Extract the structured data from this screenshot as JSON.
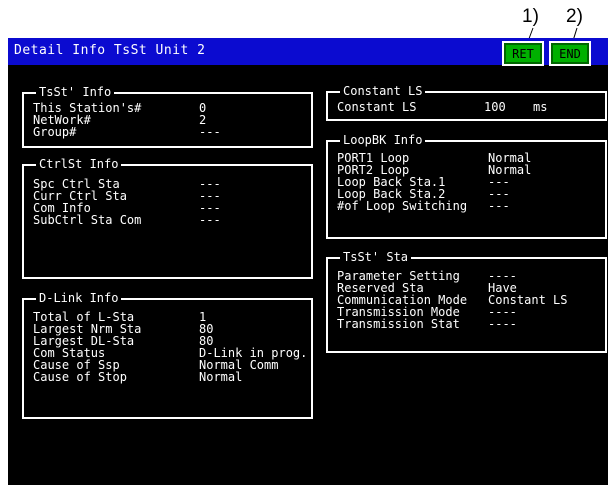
{
  "callouts": [
    "1)",
    "2)"
  ],
  "header": {
    "title": "Detail Info TsSt Unit  2",
    "ret_label": "RET",
    "end_label": "END"
  },
  "tsst_info": {
    "title": "TsSt' Info",
    "rows": [
      {
        "label": "This Station's#",
        "value": "0"
      },
      {
        "label": "NetWork#",
        "value": "2"
      },
      {
        "label": "Group#",
        "value": "---"
      }
    ]
  },
  "ctrlst_info": {
    "title": "CtrlSt Info",
    "rows": [
      {
        "label": "Spc Ctrl Sta",
        "value": "---"
      },
      {
        "label": "Curr Ctrl Sta",
        "value": "---"
      },
      {
        "label": "Com Info",
        "value": "---"
      },
      {
        "label": "SubCtrl Sta Com",
        "value": "---"
      }
    ]
  },
  "dlink_info": {
    "title": "D-Link Info",
    "rows": [
      {
        "label": "Total of L-Sta",
        "value": "1"
      },
      {
        "label": "Largest Nrm Sta",
        "value": "80"
      },
      {
        "label": "Largest DL-Sta",
        "value": "80"
      },
      {
        "label": "Com Status",
        "value": "D-Link in prog."
      },
      {
        "label": "Cause of Ssp",
        "value": "Normal Comm"
      },
      {
        "label": "Cause of Stop",
        "value": "Normal"
      }
    ]
  },
  "constant_ls": {
    "title": "Constant LS",
    "label": "Constant LS",
    "value": "100",
    "unit": "ms"
  },
  "loopbk_info": {
    "title": "LoopBK Info",
    "rows": [
      {
        "label": "PORT1 Loop",
        "value": "Normal"
      },
      {
        "label": "PORT2 Loop",
        "value": "Normal"
      },
      {
        "label": "Loop Back Sta.1",
        "value": "---"
      },
      {
        "label": "Loop Back Sta.2",
        "value": "---"
      },
      {
        "label": "#of Loop Switching",
        "value": "---"
      }
    ]
  },
  "tsst_sta": {
    "title": "TsSt' Sta",
    "rows": [
      {
        "label": "Parameter Setting",
        "value": "----"
      },
      {
        "label": "Reserved Sta",
        "value": "Have"
      },
      {
        "label": "Communication Mode",
        "value": "Constant LS"
      },
      {
        "label": "Transmission Mode",
        "value": "----"
      },
      {
        "label": "Transmission Stat",
        "value": "----"
      }
    ]
  }
}
